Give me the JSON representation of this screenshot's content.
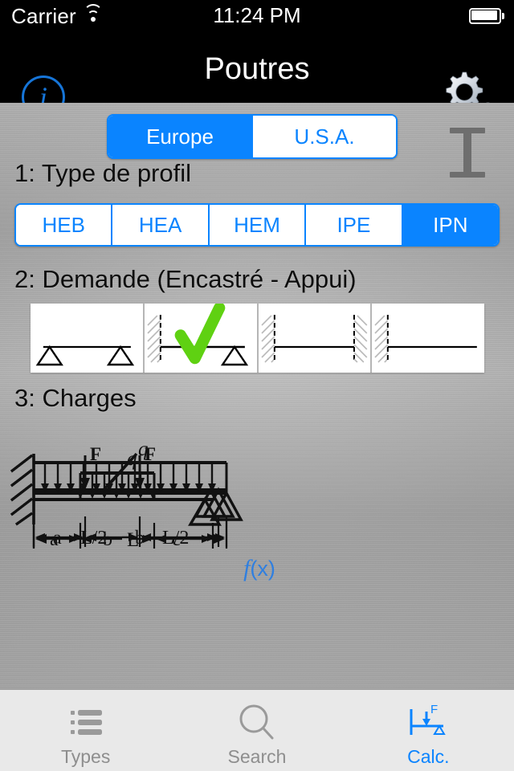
{
  "status_bar": {
    "carrier": "Carrier",
    "wifi_icon": "wifi-icon",
    "time": "11:24 PM",
    "battery_icon": "battery-full-icon"
  },
  "nav_bar": {
    "title": "Poutres",
    "info_button_label": "i",
    "settings_icon": "gears-icon"
  },
  "region_selector": {
    "options": [
      {
        "label": "Europe",
        "selected": true
      },
      {
        "label": "U.S.A.",
        "selected": false
      }
    ],
    "active_color": "#0a84ff",
    "inactive_color": "#ffffff"
  },
  "profile_preview": {
    "icon": "i-beam-profile-icon",
    "color": "#6e6e6e"
  },
  "steps": {
    "step1_title": "1: Type de profil",
    "step2_title": "2: Demande (Encastré - Appui)",
    "step3_title": "3: Charges"
  },
  "profile_types": {
    "options": [
      {
        "label": "HEB",
        "selected": false
      },
      {
        "label": "HEA",
        "selected": false
      },
      {
        "label": "HEM",
        "selected": false
      },
      {
        "label": "IPE",
        "selected": false
      },
      {
        "label": "IPN",
        "selected": true
      }
    ]
  },
  "demand": {
    "cells": [
      {
        "name": "simple-support-support",
        "selected": false
      },
      {
        "name": "fixed-support",
        "selected": true
      },
      {
        "name": "fixed-fixed",
        "selected": false
      },
      {
        "name": "cantilever",
        "selected": false
      }
    ],
    "check_color": "#5fd112"
  },
  "charges": {
    "fx_label_f": "f",
    "fx_label_x": "(x)",
    "fx_color": "#2f7fe0",
    "diagrams": [
      {
        "name": "point-load-midspan",
        "force_label": "F",
        "dim_labels": [
          "L/2",
          "L/2"
        ]
      },
      {
        "name": "point-load-arbitrary",
        "force_label": "F",
        "dim_labels": [
          "a",
          "b"
        ]
      },
      {
        "name": "uniform-load-full",
        "force_label": "q",
        "dim_labels": [
          "L"
        ]
      },
      {
        "name": "uniform-load-partial",
        "force_label": "q",
        "dim_labels": [
          "a",
          "b",
          "c"
        ]
      }
    ]
  },
  "tab_bar": {
    "tabs": [
      {
        "label": "Types",
        "icon": "list-icon",
        "active": false
      },
      {
        "label": "Search",
        "icon": "search-icon",
        "active": false
      },
      {
        "label": "Calc.",
        "icon": "beam-calc-icon",
        "active": true
      }
    ],
    "active_color": "#0a84ff",
    "inactive_color": "#8e8e8e"
  }
}
